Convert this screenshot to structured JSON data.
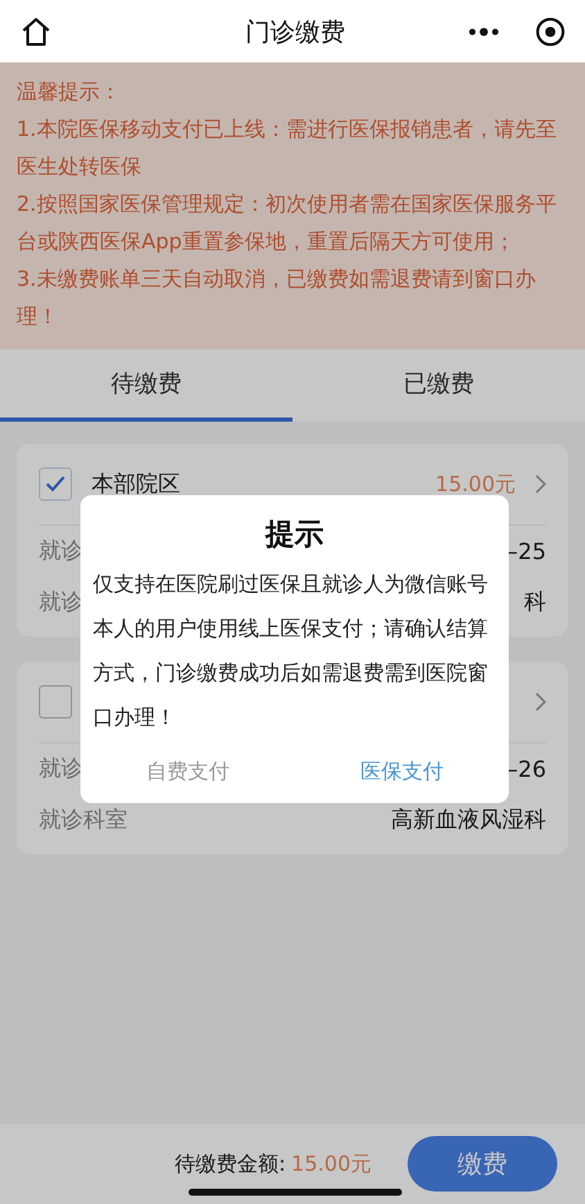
{
  "header": {
    "title": "门诊缴费"
  },
  "notice": {
    "title": "温馨提示：",
    "lines": [
      "1.本院医保移动支付已上线：需进行医保报销患者，请先至医生处转医保",
      "2.按照国家医保管理规定：初次使用者需在国家医保服务平台或陕西医保App重置参保地，重置后隔天方可使用；",
      "3.未缴费账单三天自动取消，已缴费如需退费请到窗口办理！"
    ]
  },
  "tabs": [
    {
      "label": "待缴费",
      "selected": true
    },
    {
      "label": "已缴费",
      "selected": false
    }
  ],
  "bills": [
    {
      "checked": true,
      "campus": "本部院区",
      "amount": "15.00元",
      "rows": [
        {
          "label": "就诊",
          "value": "–25"
        },
        {
          "label": "就诊",
          "value": "科"
        }
      ]
    },
    {
      "checked": false,
      "rows": [
        {
          "label": "就诊",
          "value": "–26"
        },
        {
          "label": "就诊科室",
          "value": "高新血液风湿科"
        }
      ]
    }
  ],
  "footer": {
    "total_label": "待缴费金额:",
    "total_amount": "15.00元",
    "pay_button": "缴费"
  },
  "dialog": {
    "title": "提示",
    "message": "仅支持在医院刷过医保且就诊人为微信账号本人的用户使用线上医保支付；请确认结算方式，门诊缴费成功后如需退费需到医院窗口办理！",
    "buttons": [
      {
        "label": "自费支付",
        "kind": "secondary"
      },
      {
        "label": "医保支付",
        "kind": "primary"
      }
    ]
  }
}
